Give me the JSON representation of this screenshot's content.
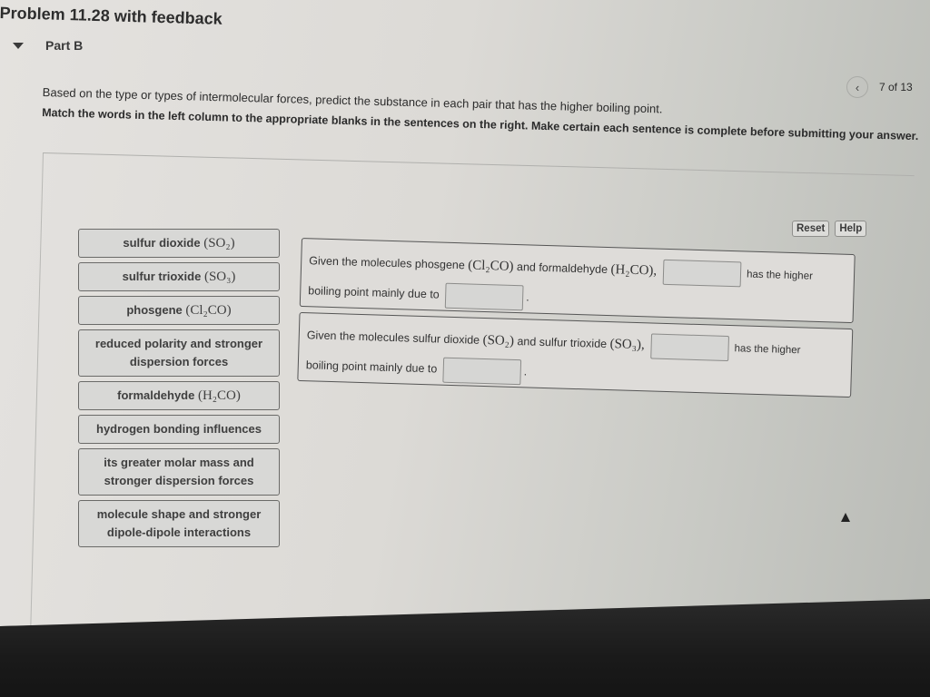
{
  "problem": {
    "title": "Problem 11.28 with feedback",
    "part_label": "Part B"
  },
  "pager": {
    "prev_icon": "chevron-left-icon",
    "prev_glyph": "‹",
    "position_text": "7 of 13"
  },
  "instructions": {
    "question": "Based on the type or types of intermolecular forces, predict the substance in each pair that has the higher boiling point.",
    "match_text": "Match the words in the left column to the appropriate blanks in the sentences on the right. Make certain each sentence is complete before submitting your answer."
  },
  "toolbar": {
    "reset_label": "Reset",
    "help_label": "Help"
  },
  "word_bank": [
    {
      "text": "sulfur dioxide",
      "formula": "(SO₂)"
    },
    {
      "text": "sulfur trioxide",
      "formula": "(SO₃)"
    },
    {
      "text": "phosgene",
      "formula": "(Cl₂CO)"
    },
    {
      "text": "reduced polarity and stronger dispersion forces",
      "formula": ""
    },
    {
      "text": "formaldehyde",
      "formula": "(H₂CO)"
    },
    {
      "text": "hydrogen bonding influences",
      "formula": ""
    },
    {
      "text": "its greater molar mass and stronger dispersion forces",
      "formula": ""
    },
    {
      "text": "molecule shape and stronger dipole-dipole interactions",
      "formula": ""
    }
  ],
  "sentences": [
    {
      "prefix": "Given the molecules phosgene",
      "formula_a": "(Cl₂CO)",
      "middle": "and formaldehyde",
      "formula_b": "(H₂CO),",
      "after_blank1": "has the higher",
      "line2": "boiling point mainly due to",
      "end": ".",
      "blank1_value": "",
      "blank2_value": ""
    },
    {
      "prefix": "Given the molecules sulfur dioxide",
      "formula_a": "(SO₂)",
      "middle": "and sulfur trioxide",
      "formula_b": "(SO₃),",
      "after_blank1": "has the higher",
      "line2": "boiling point mainly due to",
      "end": ".",
      "blank1_value": "",
      "blank2_value": ""
    }
  ]
}
